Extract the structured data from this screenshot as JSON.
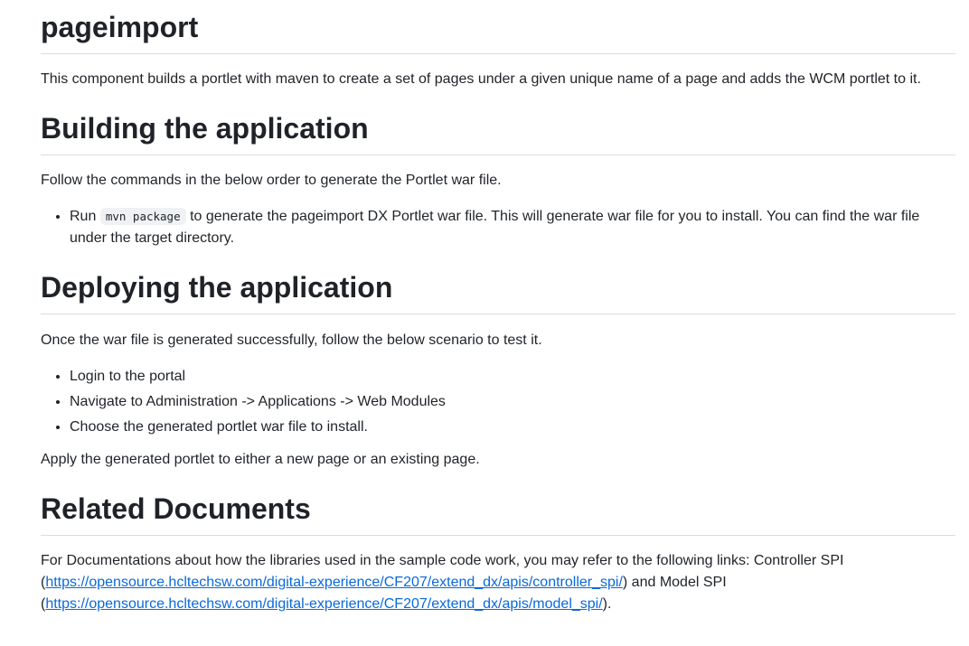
{
  "title": "pageimport",
  "intro": "This component builds a portlet with maven to create a set of pages under a given unique name of a page and adds the WCM portlet to it.",
  "building": {
    "heading": "Building the application",
    "text": "Follow the commands in the below order to generate the Portlet war file.",
    "item_prefix": "Run",
    "item_code": "mvn package",
    "item_suffix": "to generate the pageimport DX Portlet war file. This will generate war file for you to install. You can find the war file under the target directory."
  },
  "deploying": {
    "heading": "Deploying the application",
    "text": "Once the war file is generated successfully, follow the below scenario to test it.",
    "items": [
      "Login to the portal",
      "Navigate to Administration -> Applications -> Web Modules",
      "Choose the generated portlet war file to install."
    ],
    "after": "Apply the generated portlet to either a new page or an existing page."
  },
  "related": {
    "heading": "Related Documents",
    "text_before": "For Documentations about how the libraries used in the sample code work, you may refer to the following links: Controller SPI (",
    "link1": "https://opensource.hcltechsw.com/digital-experience/CF207/extend_dx/apis/controller_spi/",
    "text_middle": ") and Model SPI (",
    "link2": "https://opensource.hcltechsw.com/digital-experience/CF207/extend_dx/apis/model_spi/",
    "text_after": ")."
  }
}
